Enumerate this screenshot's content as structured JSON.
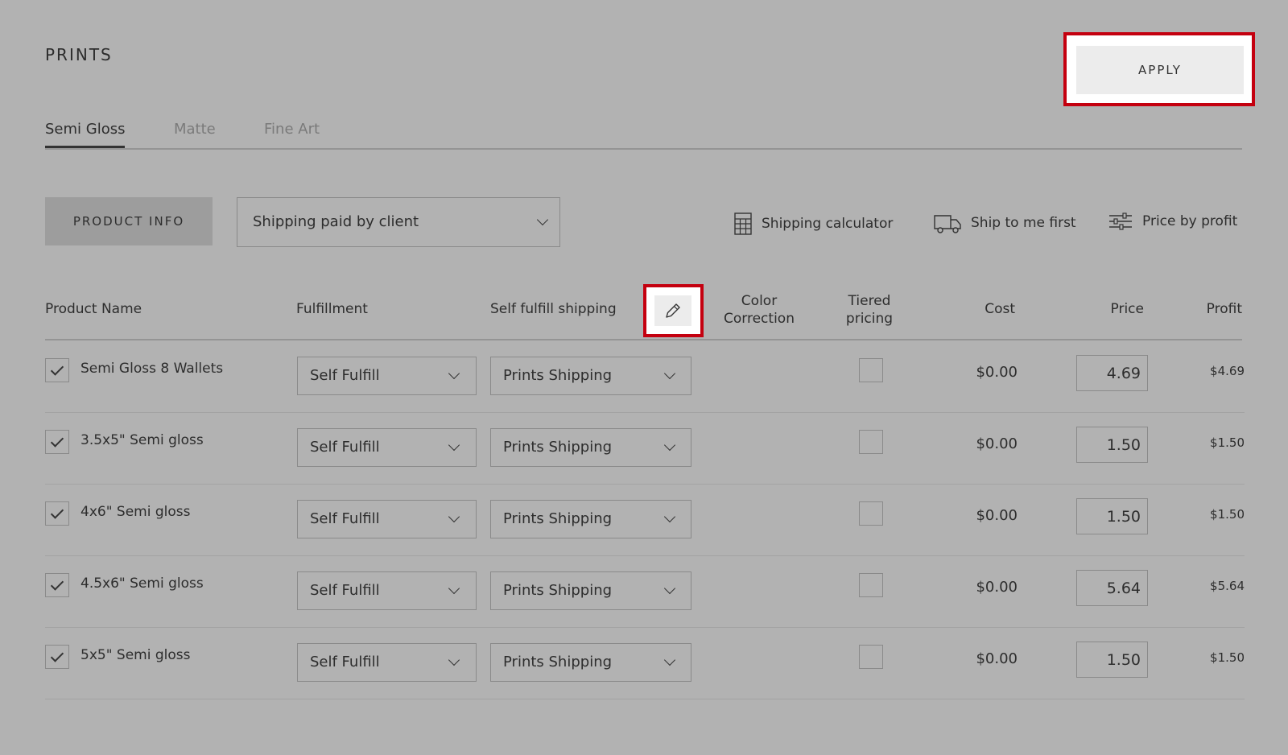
{
  "page": {
    "title": "PRINTS"
  },
  "apply_label": "APPLY",
  "tabs": [
    {
      "label": "Semi Gloss",
      "active": true
    },
    {
      "label": "Matte",
      "active": false
    },
    {
      "label": "Fine Art",
      "active": false
    }
  ],
  "toolbar": {
    "product_info_label": "PRODUCT INFO",
    "shipping_mode": "Shipping paid by client",
    "tools": [
      {
        "label": "Shipping calculator",
        "icon": "calculator-icon"
      },
      {
        "label": "Ship to me first",
        "icon": "truck-icon"
      },
      {
        "label": "Price by profit",
        "icon": "sliders-icon"
      }
    ]
  },
  "columns": {
    "product_name": "Product Name",
    "fulfillment": "Fulfillment",
    "self_fulfill_shipping": "Self fulfill shipping",
    "color_correction": "Color Correction",
    "tiered_pricing": "Tiered pricing",
    "cost": "Cost",
    "price": "Price",
    "profit": "Profit"
  },
  "rows": [
    {
      "name": "Semi Gloss 8 Wallets",
      "fulfillment": "Self Fulfill",
      "shipping": "Prints Shipping",
      "cost": "$0.00",
      "price": "4.69",
      "profit": "$4.69",
      "checked": true,
      "tiered": false
    },
    {
      "name": "3.5x5\" Semi gloss",
      "fulfillment": "Self Fulfill",
      "shipping": "Prints Shipping",
      "cost": "$0.00",
      "price": "1.50",
      "profit": "$1.50",
      "checked": true,
      "tiered": false
    },
    {
      "name": "4x6\" Semi gloss",
      "fulfillment": "Self Fulfill",
      "shipping": "Prints Shipping",
      "cost": "$0.00",
      "price": "1.50",
      "profit": "$1.50",
      "checked": true,
      "tiered": false
    },
    {
      "name": "4.5x6\" Semi gloss",
      "fulfillment": "Self Fulfill",
      "shipping": "Prints Shipping",
      "cost": "$0.00",
      "price": "5.64",
      "profit": "$5.64",
      "checked": true,
      "tiered": false
    },
    {
      "name": "5x5\" Semi gloss",
      "fulfillment": "Self Fulfill",
      "shipping": "Prints Shipping",
      "cost": "$0.00",
      "price": "1.50",
      "profit": "$1.50",
      "checked": true,
      "tiered": false
    }
  ],
  "colors": {
    "background": "#b2b2b2",
    "highlight": "#c4000f",
    "button": "#ececec"
  }
}
